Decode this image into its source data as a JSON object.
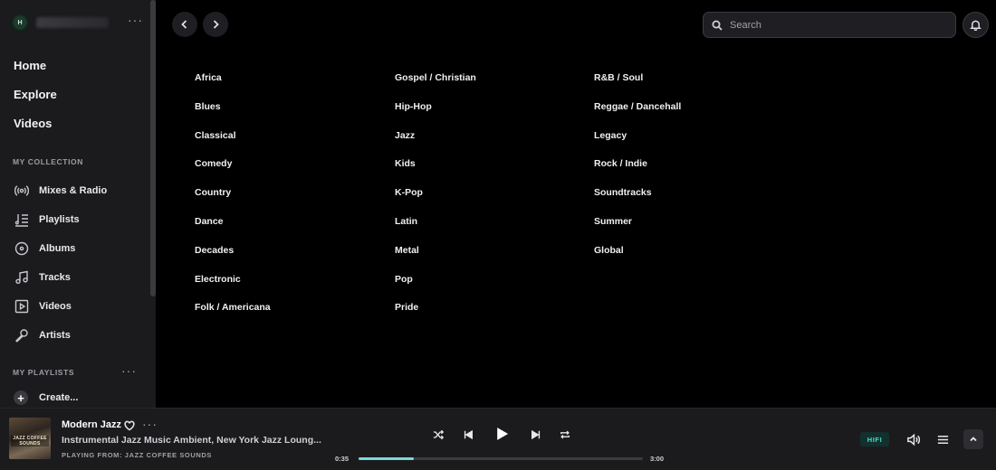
{
  "sidebar": {
    "profile_initial": "H",
    "more_label": "···",
    "main_nav": [
      {
        "label": "Home"
      },
      {
        "label": "Explore"
      },
      {
        "label": "Videos"
      }
    ],
    "collection_title": "MY COLLECTION",
    "collection_items": [
      {
        "label": "Mixes & Radio",
        "icon": "radio-icon"
      },
      {
        "label": "Playlists",
        "icon": "playlist-icon"
      },
      {
        "label": "Albums",
        "icon": "album-icon"
      },
      {
        "label": "Tracks",
        "icon": "music-note-icon"
      },
      {
        "label": "Videos",
        "icon": "video-icon"
      },
      {
        "label": "Artists",
        "icon": "microphone-icon"
      }
    ],
    "playlists_title": "MY PLAYLISTS",
    "create_label": "Create..."
  },
  "search": {
    "placeholder": "Search"
  },
  "genres": {
    "column_1": [
      "Africa",
      "Blues",
      "Classical",
      "Comedy",
      "Country",
      "Dance",
      "Decades",
      "Electronic",
      "Folk / Americana"
    ],
    "column_2": [
      "Gospel / Christian",
      "Hip-Hop",
      "Jazz",
      "Kids",
      "K-Pop",
      "Latin",
      "Metal",
      "Pop",
      "Pride"
    ],
    "column_3": [
      "R&B / Soul",
      "Reggae / Dancehall",
      "Legacy",
      "Rock / Indie",
      "Soundtracks",
      "Summer",
      "Global"
    ]
  },
  "player": {
    "cover_text": "JAZZ COFFEE SOUNDS",
    "title": "Modern Jazz",
    "subtitle": "Instrumental Jazz Music Ambient, New York Jazz Loung...",
    "playing_from": "PLAYING FROM: JAZZ COFFEE SOUNDS",
    "elapsed": "0:35",
    "duration": "3:00",
    "progress_fraction": 0.194,
    "quality_badge": "HIFI",
    "accent_color": "#7fd8d8"
  }
}
